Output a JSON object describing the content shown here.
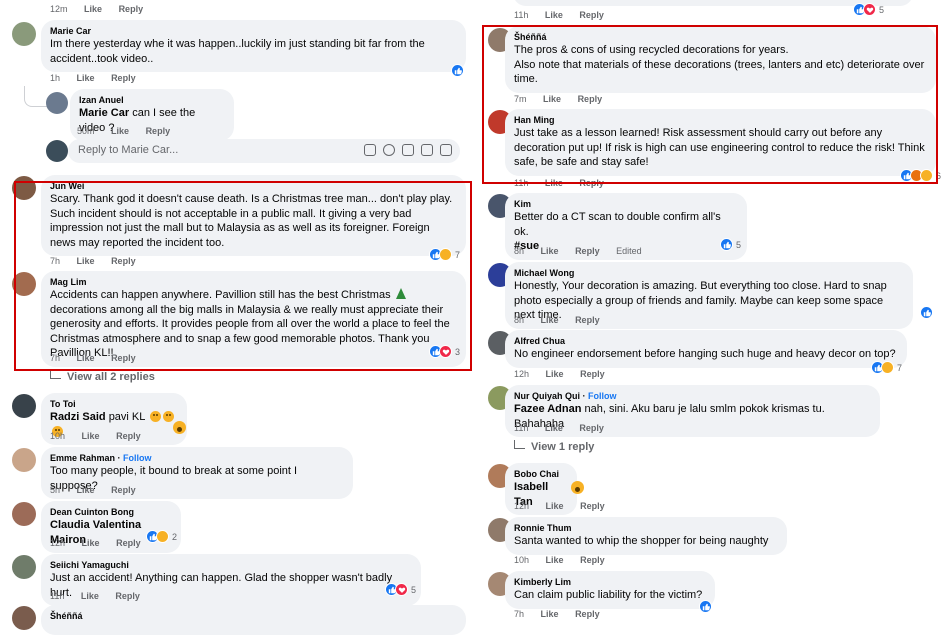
{
  "actions": {
    "like": "Like",
    "reply": "Reply",
    "edited": "Edited"
  },
  "left_column": {
    "top_stub": {
      "time": "12m"
    },
    "comments": [
      {
        "name": "Marie Car",
        "text": "Im there yesterday whe it was happen..luckily im just standing bit far from the accident..took video..",
        "time": "1h",
        "reactions": [
          "like"
        ],
        "count": ""
      },
      {
        "name": "Izan Anuel",
        "tag": "Marie Car",
        "text": "can I see the video ?",
        "time": "50m"
      },
      {
        "name": "Jun Wei",
        "text": "Scary. Thank god it doesn't cause death. Is a Christmas tree man... don't play play. Such incident should is not acceptable in a public mall. It giving a very bad impression not just the mall but to Malaysia as as well as its foreigner. Foreign news may reported the incident too.",
        "time": "7h",
        "reactions": [
          "like",
          "haha"
        ],
        "count": "7"
      },
      {
        "name": "Mag Lim",
        "text_a": "Accidents can happen anywhere. Pavillion still has the best Christmas",
        "text_b": "decorations among all the big malls in Malaysia & we really must appreciate their generosity and efforts. It provides people from all over the world a place to feel the Christmas atmosphere and to snap a few good memorable photos. Thank you Pavillion KL!!",
        "time": "7h",
        "reactions": [
          "like",
          "love"
        ],
        "count": "3"
      },
      {
        "name": "To Toi",
        "tag": "Radzi Said",
        "text": "pavi KL",
        "time": "10h"
      },
      {
        "name": "Emme Rahman",
        "follow": "Follow",
        "text": "Too many people, it bound to break at some point I suppose?",
        "time": "5h"
      },
      {
        "name": "Dean Cuinton Bong",
        "tag": "Claudia Valentina Mairon",
        "text": "",
        "time": "12h",
        "reactions": [
          "like",
          "haha"
        ],
        "count": "2"
      },
      {
        "name": "Seiichi Yamaguchi",
        "text": "Just an accident! Anything can happen. Glad the shopper wasn't badly hurt.",
        "time": "11h",
        "reactions": [
          "like",
          "love"
        ],
        "count": "5"
      },
      {
        "name": "Šhéññá"
      }
    ],
    "reply_box_placeholder": "Reply to Marie Car...",
    "view_replies": "View all 2 replies"
  },
  "right_column": {
    "top_stub": {
      "time": "11h",
      "count": "5"
    },
    "comments": [
      {
        "name": "Šhéññá",
        "text": "The pros & cons of using recycled decorations for years.\nAlso note that materials of these decorations (trees, lanters and etc) deteriorate over time.",
        "time": "7m"
      },
      {
        "name": "Han Ming",
        "text": "Just take as a lesson learned! Risk assessment should carry out before any decoration put up! If risk is high can use engineering control to reduce the risk! Think safe, be safe and stay safe!",
        "time": "11h",
        "reactions": [
          "like",
          "angry",
          "haha"
        ],
        "count": "6"
      },
      {
        "name": "Kim",
        "text": "Better do a CT scan to double confirm all's ok.",
        "hashtag": "#sue",
        "time": "8h",
        "edited": true,
        "reactions": [
          "like"
        ],
        "count": "5"
      },
      {
        "name": "Michael Wong",
        "text": "Honestly, Your decoration is amazing. But everything too close. Hard to snap photo especially a group of friends and family. Maybe can keep some space next time.",
        "time": "8h",
        "reactions": [
          "like"
        ],
        "count": ""
      },
      {
        "name": "Alfred Chua",
        "text": "No engineer endorsement before hanging such huge and heavy decor on top?",
        "time": "12h",
        "reactions": [
          "like",
          "haha"
        ],
        "count": "7"
      },
      {
        "name": "Nur Quiyah Qui",
        "follow": "Follow",
        "tag": "Fazee Adnan",
        "text": "nah, sini. Aku baru je lalu smlm pokok krismas tu. Bahahaha",
        "time": "11h"
      },
      {
        "name": "Bobo Chai",
        "tag": "Isabell Tan",
        "text": "",
        "time": "12h"
      },
      {
        "name": "Ronnie Thum",
        "text": "Santa wanted to whip the shopper for being naughty",
        "time": "10h"
      },
      {
        "name": "Kimberly Lim",
        "text": "Can claim public liability for the victim?",
        "time": "7h",
        "reactions": [
          "like"
        ],
        "count": ""
      }
    ],
    "view_replies": "View 1 reply"
  },
  "colors": {
    "bubble": "#f0f2f5",
    "like": "#1877f2",
    "love": "#f02849",
    "haha": "#f7b125",
    "angry": "#e9710f",
    "highlight_box": "#d00000",
    "meta": "#65676b"
  },
  "avatar_colors": [
    "#8a9a7b",
    "#6b7a8f",
    "#3b4d5a",
    "#7d5a44",
    "#5b5f63",
    "#a26b4f",
    "#38424a",
    "#c9a58a",
    "#9c6b58",
    "#6f7c6a",
    "#7a5c4d",
    "#2c3e99",
    "#49556b",
    "#8b9a5f",
    "#b07b5a",
    "#8f7a6a",
    "#a58873"
  ]
}
